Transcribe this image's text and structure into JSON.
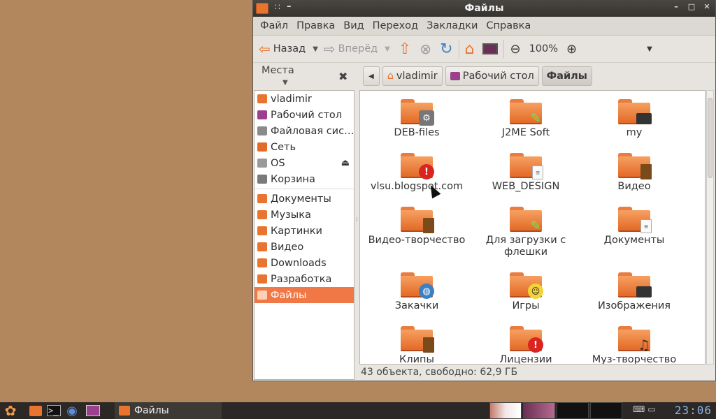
{
  "window": {
    "title": "Файлы",
    "title_buttons": [
      "–",
      "□",
      "✕"
    ]
  },
  "menu": [
    "Файл",
    "Правка",
    "Вид",
    "Переход",
    "Закладки",
    "Справка"
  ],
  "toolbar": {
    "back_label": "Назад",
    "forward_label": "Вперёд",
    "zoom_value": "100%"
  },
  "locbar": {
    "places_label": "Места",
    "crumbs": [
      "vladimir",
      "Рабочий стол",
      "Файлы"
    ]
  },
  "sidebar": {
    "items": [
      {
        "label": "vladimir",
        "icon": "home-icon",
        "color": "#e8742f"
      },
      {
        "label": "Рабочий стол",
        "icon": "desktop-icon",
        "color": "#9c3f8f"
      },
      {
        "label": "Файловая сис…",
        "icon": "drive-icon",
        "color": "#8a8a8a"
      },
      {
        "label": "Сеть",
        "icon": "network-icon",
        "color": "#e36a27"
      },
      {
        "label": "OS",
        "icon": "disk-icon",
        "color": "#9a9a9a"
      },
      {
        "label": "Корзина",
        "icon": "trash-icon",
        "color": "#7a7a7a"
      },
      {
        "label": "Документы",
        "icon": "folder-icon",
        "color": "#e8742f"
      },
      {
        "label": "Музыка",
        "icon": "folder-music-icon",
        "color": "#e8742f"
      },
      {
        "label": "Картинки",
        "icon": "folder-pictures-icon",
        "color": "#e8742f"
      },
      {
        "label": "Видео",
        "icon": "folder-video-icon",
        "color": "#e8742f"
      },
      {
        "label": "Downloads",
        "icon": "folder-icon",
        "color": "#e8742f"
      },
      {
        "label": "Разработка",
        "icon": "folder-icon",
        "color": "#e8742f"
      },
      {
        "label": "Файлы",
        "icon": "folder-icon",
        "color": "#e8742f"
      }
    ],
    "selected": "Файлы"
  },
  "files": [
    {
      "name": "DEB-files",
      "emblem": "gear"
    },
    {
      "name": "J2ME Soft",
      "emblem": "brush"
    },
    {
      "name": "my",
      "emblem": "monitor"
    },
    {
      "name": "vlsu.blogspot.com",
      "emblem": "alert"
    },
    {
      "name": "WEB_DESIGN",
      "emblem": "doc"
    },
    {
      "name": "Видео",
      "emblem": "film"
    },
    {
      "name": "Видео-творчество",
      "emblem": "film"
    },
    {
      "name": "Для загрузки с флешки",
      "emblem": "brush"
    },
    {
      "name": "Документы",
      "emblem": "doc"
    },
    {
      "name": "Закачки",
      "emblem": "globe"
    },
    {
      "name": "Игры",
      "emblem": "smile"
    },
    {
      "name": "Изображения",
      "emblem": "monitor"
    },
    {
      "name": "Клипы",
      "emblem": "film"
    },
    {
      "name": "Лицензии",
      "emblem": "alert"
    },
    {
      "name": "Муз-творчество",
      "emblem": "note"
    }
  ],
  "status": "43 объекта, свободно: 62,9 ГБ",
  "taskbar": {
    "active_task": "Файлы",
    "clock": "23:06"
  },
  "colors": {
    "accent": "#f07746",
    "desktop": "#b2875e",
    "folder": "#e8742f"
  }
}
